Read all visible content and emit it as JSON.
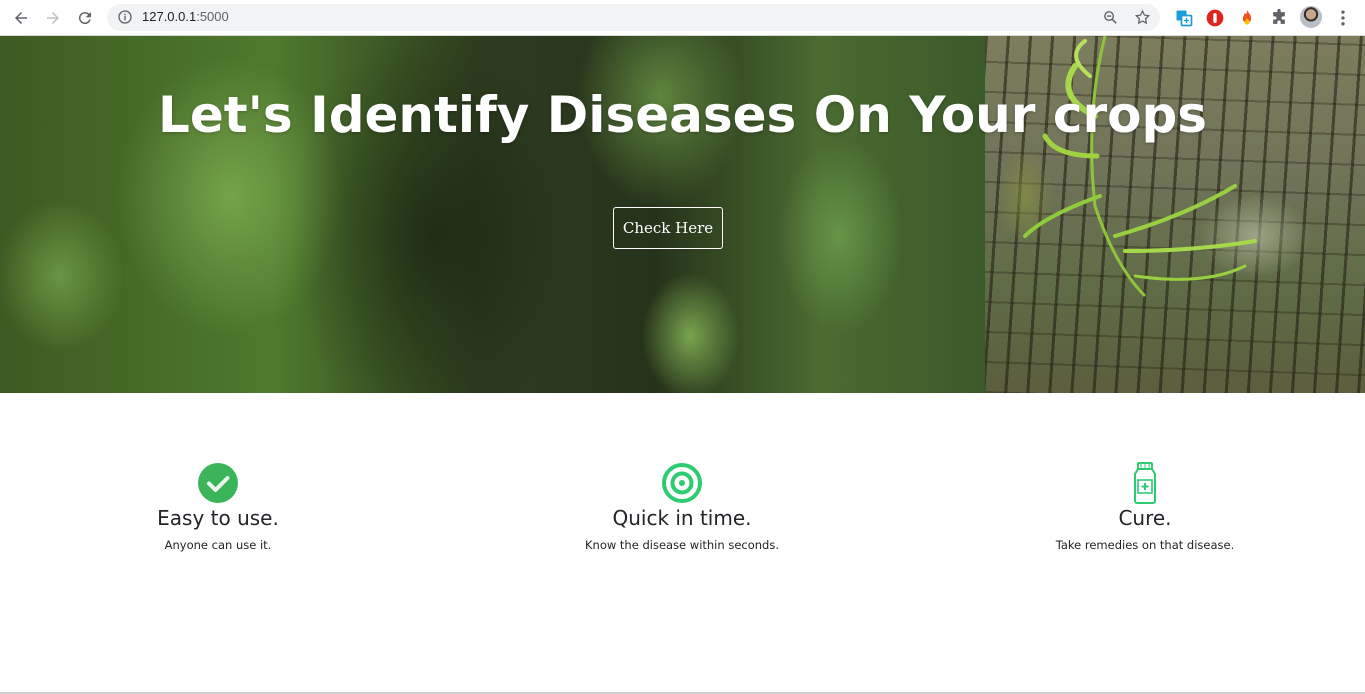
{
  "browser": {
    "url_host": "127.0.0.1",
    "url_port": ":5000",
    "icons": {
      "back": "back-arrow-icon",
      "forward": "forward-arrow-icon",
      "reload": "reload-icon",
      "site_info": "info-icon",
      "zoom": "zoom-icon",
      "bookmark": "star-icon",
      "extensions": [
        "translate-extension-icon",
        "adblock-extension-icon",
        "fire-extension-icon",
        "puzzle-extensions-icon"
      ],
      "profile": "avatar",
      "menu": "more-vert-icon"
    }
  },
  "hero": {
    "title": "Let's Identify Diseases On Your crops",
    "button_label": "Check Here"
  },
  "features": [
    {
      "icon": "checkmark-circle-icon",
      "title": "Easy to use.",
      "description": "Anyone can use it."
    },
    {
      "icon": "target-icon",
      "title": "Quick in time.",
      "description": "Know the disease within seconds."
    },
    {
      "icon": "medicine-bottle-icon",
      "title": "Cure.",
      "description": "Take remedies on that disease."
    }
  ],
  "colors": {
    "accent_green": "#2ecc71",
    "check_green": "#3cb55a",
    "text_dark": "#212529",
    "hero_text": "#ffffff"
  }
}
